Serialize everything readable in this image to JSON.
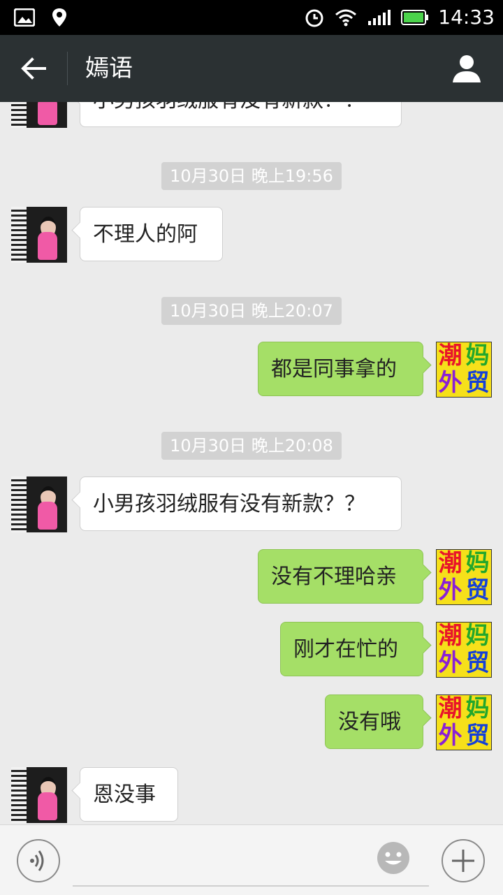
{
  "status_bar": {
    "time": "14:33"
  },
  "header": {
    "title": "嫣语"
  },
  "self_avatar": {
    "chars": [
      "潮",
      "妈",
      "外",
      "贸"
    ],
    "colors": [
      "#e8152a",
      "#23a72c",
      "#8a1fd6",
      "#1440d8"
    ]
  },
  "messages": [
    {
      "type": "text",
      "from": "other",
      "text": "小男孩羽绒服有没有新款？？"
    },
    {
      "type": "time",
      "text": "10月30日 晚上19:56"
    },
    {
      "type": "text",
      "from": "other",
      "text": "不理人的阿"
    },
    {
      "type": "time",
      "text": "10月30日 晚上20:07"
    },
    {
      "type": "text",
      "from": "self",
      "text": "都是同事拿的"
    },
    {
      "type": "time",
      "text": "10月30日 晚上20:08"
    },
    {
      "type": "text",
      "from": "other",
      "text": "小男孩羽绒服有没有新款？？"
    },
    {
      "type": "text",
      "from": "self",
      "text": "没有不理哈亲"
    },
    {
      "type": "text",
      "from": "self",
      "text": "刚才在忙的"
    },
    {
      "type": "text",
      "from": "self",
      "text": "没有哦"
    },
    {
      "type": "text",
      "from": "other",
      "text": "恩没事"
    }
  ],
  "input": {
    "value": ""
  }
}
